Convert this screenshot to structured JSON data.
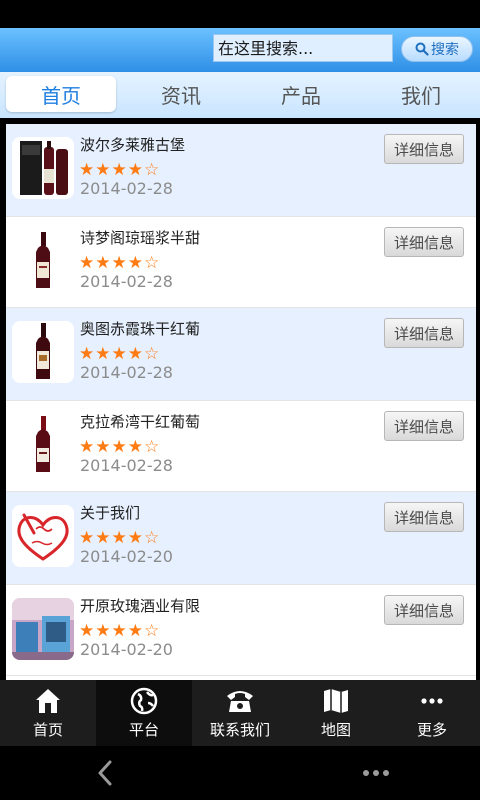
{
  "search": {
    "value": "在这里搜索...",
    "button_label": "搜索"
  },
  "tabs": [
    {
      "label": "首页",
      "active": true
    },
    {
      "label": "资讯",
      "active": false
    },
    {
      "label": "产品",
      "active": false
    },
    {
      "label": "我们",
      "active": false
    }
  ],
  "items": [
    {
      "title": "波尔多莱雅古堡",
      "rating": 4,
      "date": "2014-02-28",
      "button": "详细信息",
      "thumb": "wine-box-icon"
    },
    {
      "title": "诗梦阁琼瑶浆半甜",
      "rating": 4,
      "date": "2014-02-28",
      "button": "详细信息",
      "thumb": "wine-bottle-icon"
    },
    {
      "title": "奥图赤霞珠干红葡",
      "rating": 4,
      "date": "2014-02-28",
      "button": "详细信息",
      "thumb": "wine-bottle-icon"
    },
    {
      "title": "克拉希湾干红葡萄",
      "rating": 4,
      "date": "2014-02-28",
      "button": "详细信息",
      "thumb": "wine-bottle-icon"
    },
    {
      "title": "关于我们",
      "rating": 4,
      "date": "2014-02-20",
      "button": "详细信息",
      "thumb": "heart-about-us-icon"
    },
    {
      "title": "开原玫瑰酒业有限",
      "rating": 4,
      "date": "2014-02-20",
      "button": "详细信息",
      "thumb": "interior-photo-icon"
    }
  ],
  "bottom_nav": [
    {
      "label": "首页",
      "icon": "home-icon"
    },
    {
      "label": "平台",
      "icon": "globe-icon"
    },
    {
      "label": "联系我们",
      "icon": "phone-icon"
    },
    {
      "label": "地图",
      "icon": "map-icon"
    },
    {
      "label": "更多",
      "icon": "more-icon"
    }
  ],
  "colors": {
    "header": "#2e8fe6",
    "tab_active_text": "#1f7fe0",
    "star": "#ff7b13",
    "nav_bg": "#1d1d1d"
  }
}
